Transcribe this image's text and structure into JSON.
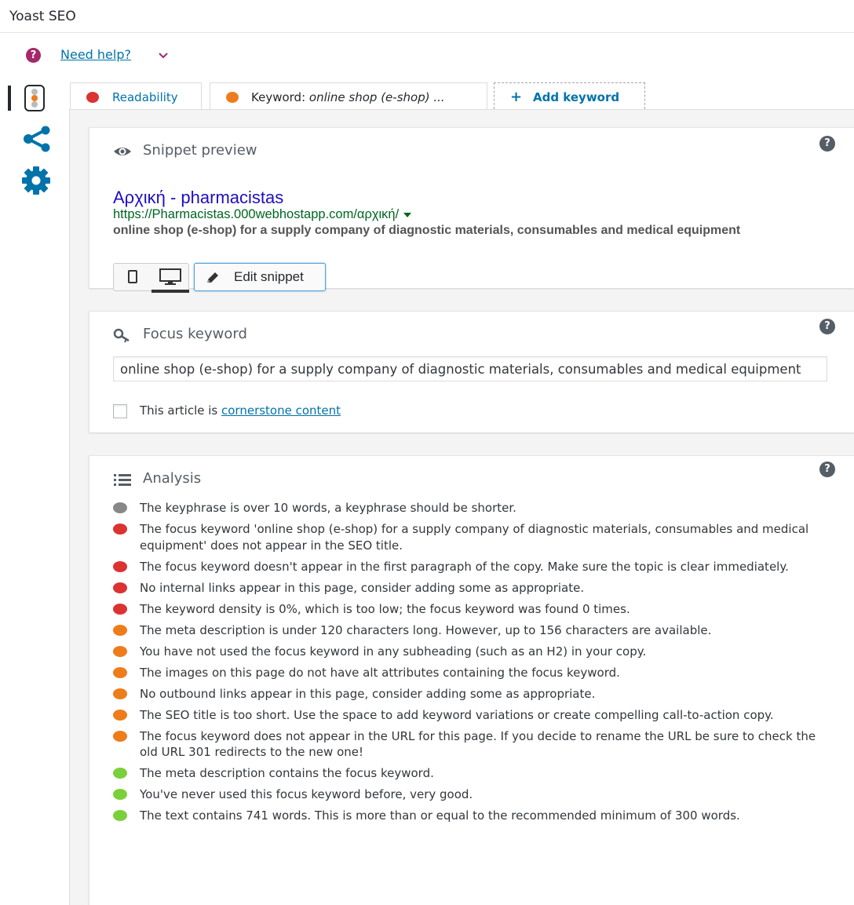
{
  "title": "Yoast SEO",
  "help": {
    "label": "Need help?"
  },
  "colors": {
    "red": "#dc3232",
    "orange": "#ee7c1b",
    "green": "#7ad03a",
    "grey": "#888888",
    "link": "#0073aa",
    "brand": "#a4286a"
  },
  "tabs": [
    {
      "label": "Readability",
      "status": "red"
    },
    {
      "prefix": "Keyword: ",
      "keyword": "online shop (e-shop) ...",
      "status": "orange"
    },
    {
      "label": "Add keyword"
    }
  ],
  "snippet": {
    "heading": "Snippet preview",
    "title": "Αρχική - pharmacistas",
    "url": "https://Pharmacistas.000webhostapp.com/αρχική/",
    "description": "online shop (e-shop) for a supply company of diagnostic materials, consumables and medical equipment",
    "edit_label": "Edit snippet"
  },
  "focus": {
    "heading": "Focus keyword",
    "value": "online shop (e-shop) for a supply company of diagnostic materials, consumables and medical equipment",
    "cornerstone_prefix": "This article is ",
    "cornerstone_link": "cornerstone content"
  },
  "analysis": {
    "heading": "Analysis",
    "items": [
      {
        "status": "grey",
        "text": "The keyphrase is over 10 words, a keyphrase should be shorter."
      },
      {
        "status": "red",
        "text": "The focus keyword 'online shop (e-shop) for a supply company of diagnostic materials, consumables and medical equipment' does not appear in the SEO title."
      },
      {
        "status": "red",
        "text": "The focus keyword doesn't appear in the first paragraph of the copy. Make sure the topic is clear immediately."
      },
      {
        "status": "red",
        "text": "No internal links appear in this page, consider adding some as appropriate."
      },
      {
        "status": "red",
        "text": "The keyword density is 0%, which is too low; the focus keyword was found 0 times."
      },
      {
        "status": "orange",
        "text": "The meta description is under 120 characters long. However, up to 156 characters are available."
      },
      {
        "status": "orange",
        "text": "You have not used the focus keyword in any subheading (such as an H2) in your copy."
      },
      {
        "status": "orange",
        "text": "The images on this page do not have alt attributes containing the focus keyword."
      },
      {
        "status": "orange",
        "text": "No outbound links appear in this page, consider adding some as appropriate."
      },
      {
        "status": "orange",
        "text": "The SEO title is too short. Use the space to add keyword variations or create compelling call-to-action copy."
      },
      {
        "status": "orange",
        "text": "The focus keyword does not appear in the URL for this page. If you decide to rename the URL be sure to check the old URL 301 redirects to the new one!"
      },
      {
        "status": "green",
        "text": "The meta description contains the focus keyword."
      },
      {
        "status": "green",
        "text": "You've never used this focus keyword before, very good."
      },
      {
        "status": "green",
        "text": "The text contains 741 words. This is more than or equal to the recommended minimum of 300 words."
      }
    ]
  }
}
